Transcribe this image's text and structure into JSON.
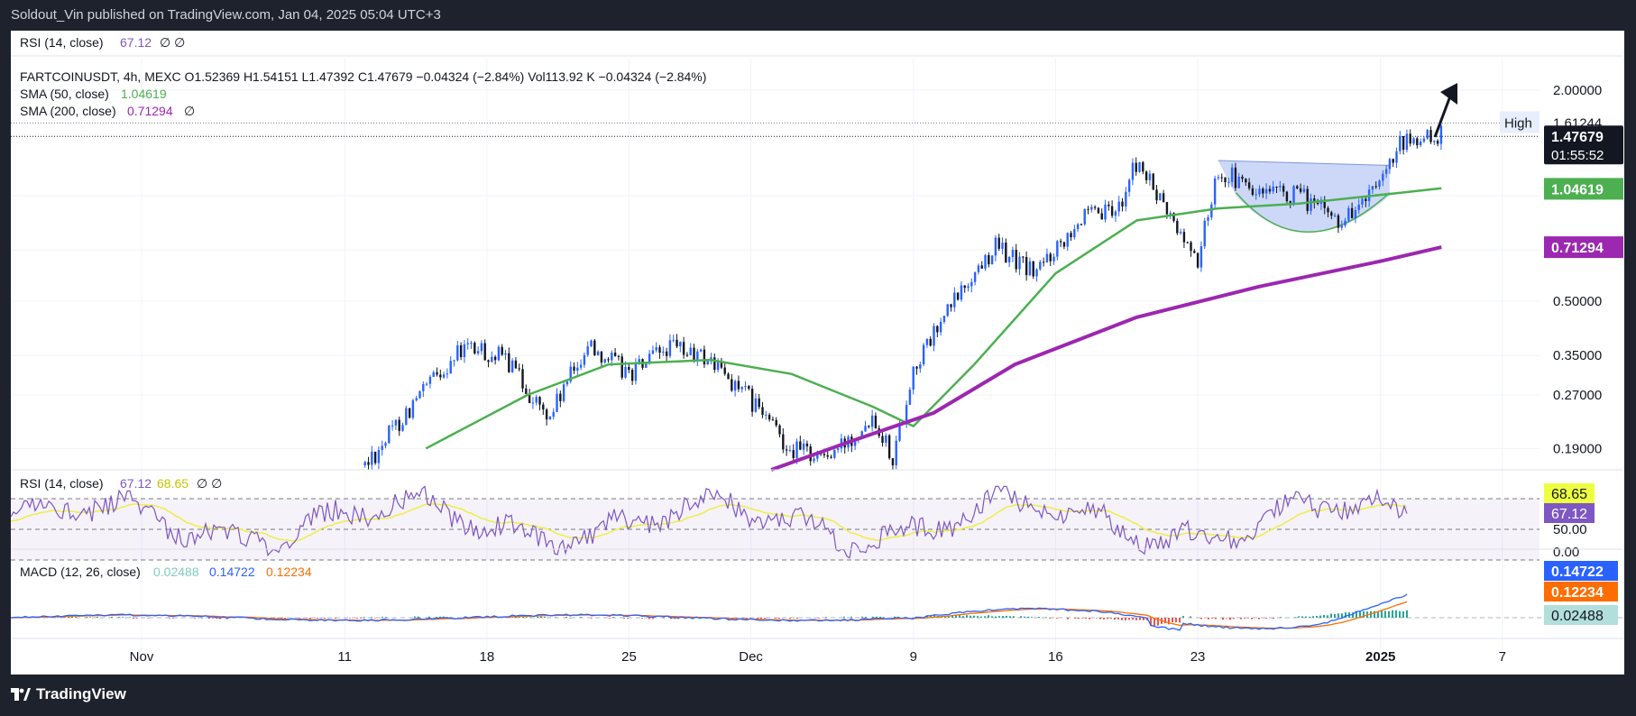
{
  "header": {
    "publisher_line": "Soldout_Vin published on TradingView.com, Jan 04, 2025 05:04 UTC+3"
  },
  "footer": {
    "brand": "TradingView",
    "brand_icon": "tradingview-logo-icon"
  },
  "top_pane": {
    "legend": {
      "name": "RSI (14, close)",
      "value": "67.12",
      "tail": "∅  ∅"
    }
  },
  "price_pane": {
    "symbol_line": "FARTCOINUSDT, 4h, MEXC  O1.52369  H1.54151  L1.47392  C1.47679  −0.04324 (−2.84%)  Vol113.92 K  −0.04324 (−2.84%)",
    "sma50": {
      "name": "SMA (50, close)",
      "value": "1.04619",
      "color": "#4caf50"
    },
    "sma200": {
      "name": "SMA (200, close)",
      "value": "0.71294",
      "tail": "∅",
      "color": "#9c27b0"
    },
    "axis_ticks": [
      "2.00000",
      "0.50000",
      "0.35000",
      "0.27000",
      "0.19000"
    ],
    "high_label": "High",
    "high_value": "1.61244",
    "last_price": "1.47679",
    "countdown": "01:55:52",
    "sma50_tag": "1.04619",
    "sma200_tag": "0.71294"
  },
  "rsi_pane": {
    "legend": {
      "name": "RSI (14, close)",
      "v1": "67.12",
      "v2": "68.65",
      "tail": "∅  ∅"
    },
    "axis_ticks": [
      "50.00",
      "0.00"
    ],
    "tag_yellow": "68.65",
    "tag_purple": "67.12"
  },
  "macd_pane": {
    "legend": {
      "name": "MACD (12, 26, close)",
      "hist": "0.02488",
      "macd": "0.14722",
      "signal": "0.12234"
    },
    "tag_macd": "0.14722",
    "tag_signal": "0.12234",
    "tag_hist": "0.02488"
  },
  "time_axis": [
    "Nov",
    "11",
    "18",
    "25",
    "Dec",
    "9",
    "16",
    "23",
    "2025",
    "7"
  ],
  "colors": {
    "up": "#2962ff",
    "down": "#131722",
    "sma50": "#4caf50",
    "sma200": "#9c27b0",
    "rsi": "#7e57c2",
    "rsi_ma": "#eeee44",
    "macd": "#2962ff",
    "signal": "#ff6d00",
    "pattern_fill": "#b8c8f5"
  },
  "chart_data": {
    "type": "candlestick",
    "symbol": "FARTCOINUSDT",
    "interval": "4h",
    "exchange": "MEXC",
    "scale": "log",
    "x_ticks": [
      "Nov",
      "11",
      "18",
      "25",
      "Dec",
      "9",
      "16",
      "23",
      "2025",
      "7"
    ],
    "y_ticks": [
      2.0,
      0.5,
      0.35,
      0.27,
      0.19
    ],
    "last": {
      "open": 1.52369,
      "high": 1.54151,
      "low": 1.47392,
      "close": 1.47679,
      "change": -0.04324,
      "change_pct": -2.84,
      "volume": "113.92 K"
    },
    "high": 1.61244,
    "price_path": [
      {
        "t": "Nov 12",
        "p": 0.17
      },
      {
        "t": "Nov 14",
        "p": 0.24
      },
      {
        "t": "Nov 16",
        "p": 0.33
      },
      {
        "t": "Nov 17",
        "p": 0.37
      },
      {
        "t": "Nov 19",
        "p": 0.34
      },
      {
        "t": "Nov 21",
        "p": 0.23
      },
      {
        "t": "Nov 23",
        "p": 0.38
      },
      {
        "t": "Nov 25",
        "p": 0.31
      },
      {
        "t": "Nov 27",
        "p": 0.37
      },
      {
        "t": "Nov 29",
        "p": 0.34
      },
      {
        "t": "Dec 01",
        "p": 0.26
      },
      {
        "t": "Dec 03",
        "p": 0.19
      },
      {
        "t": "Dec 05",
        "p": 0.18
      },
      {
        "t": "Dec 07",
        "p": 0.24
      },
      {
        "t": "Dec 08",
        "p": 0.18
      },
      {
        "t": "Dec 09",
        "p": 0.32
      },
      {
        "t": "Dec 11",
        "p": 0.5
      },
      {
        "t": "Dec 13",
        "p": 0.72
      },
      {
        "t": "Dec 15",
        "p": 0.6
      },
      {
        "t": "Dec 17",
        "p": 0.85
      },
      {
        "t": "Dec 19",
        "p": 0.9
      },
      {
        "t": "Dec 20",
        "p": 1.25
      },
      {
        "t": "Dec 22",
        "p": 0.8
      },
      {
        "t": "Dec 23",
        "p": 0.65
      },
      {
        "t": "Dec 24",
        "p": 1.2
      },
      {
        "t": "Dec 26",
        "p": 1.0
      },
      {
        "t": "Dec 28",
        "p": 1.0
      },
      {
        "t": "Dec 30",
        "p": 0.85
      },
      {
        "t": "Jan 01",
        "p": 1.05
      },
      {
        "t": "Jan 02",
        "p": 1.4
      },
      {
        "t": "Jan 04",
        "p": 1.48
      }
    ],
    "sma50": [
      {
        "t": "Nov 15",
        "p": 0.19
      },
      {
        "t": "Nov 20",
        "p": 0.27
      },
      {
        "t": "Nov 24",
        "p": 0.33
      },
      {
        "t": "Nov 29",
        "p": 0.34
      },
      {
        "t": "Dec 03",
        "p": 0.31
      },
      {
        "t": "Dec 07",
        "p": 0.25
      },
      {
        "t": "Dec 09",
        "p": 0.22
      },
      {
        "t": "Dec 12",
        "p": 0.33
      },
      {
        "t": "Dec 16",
        "p": 0.6
      },
      {
        "t": "Dec 20",
        "p": 0.85
      },
      {
        "t": "Dec 24",
        "p": 0.92
      },
      {
        "t": "Dec 28",
        "p": 0.95
      },
      {
        "t": "Jan 02",
        "p": 1.02
      },
      {
        "t": "Jan 04",
        "p": 1.05
      }
    ],
    "sma200": [
      {
        "t": "Dec 02",
        "p": 0.165
      },
      {
        "t": "Dec 06",
        "p": 0.2
      },
      {
        "t": "Dec 10",
        "p": 0.24
      },
      {
        "t": "Dec 14",
        "p": 0.33
      },
      {
        "t": "Dec 20",
        "p": 0.45
      },
      {
        "t": "Dec 26",
        "p": 0.55
      },
      {
        "t": "Jan 01",
        "p": 0.65
      },
      {
        "t": "Jan 04",
        "p": 0.713
      }
    ],
    "indicators": {
      "sma50": 1.04619,
      "sma200": 0.71294,
      "rsi": 67.12,
      "rsi_ma": 68.65,
      "macd": 0.14722,
      "signal": 0.12234,
      "histogram": 0.02488
    },
    "annotations": [
      "cup-and-handle pattern (Dec 24 – Jan 01)",
      "upward arrow"
    ]
  }
}
